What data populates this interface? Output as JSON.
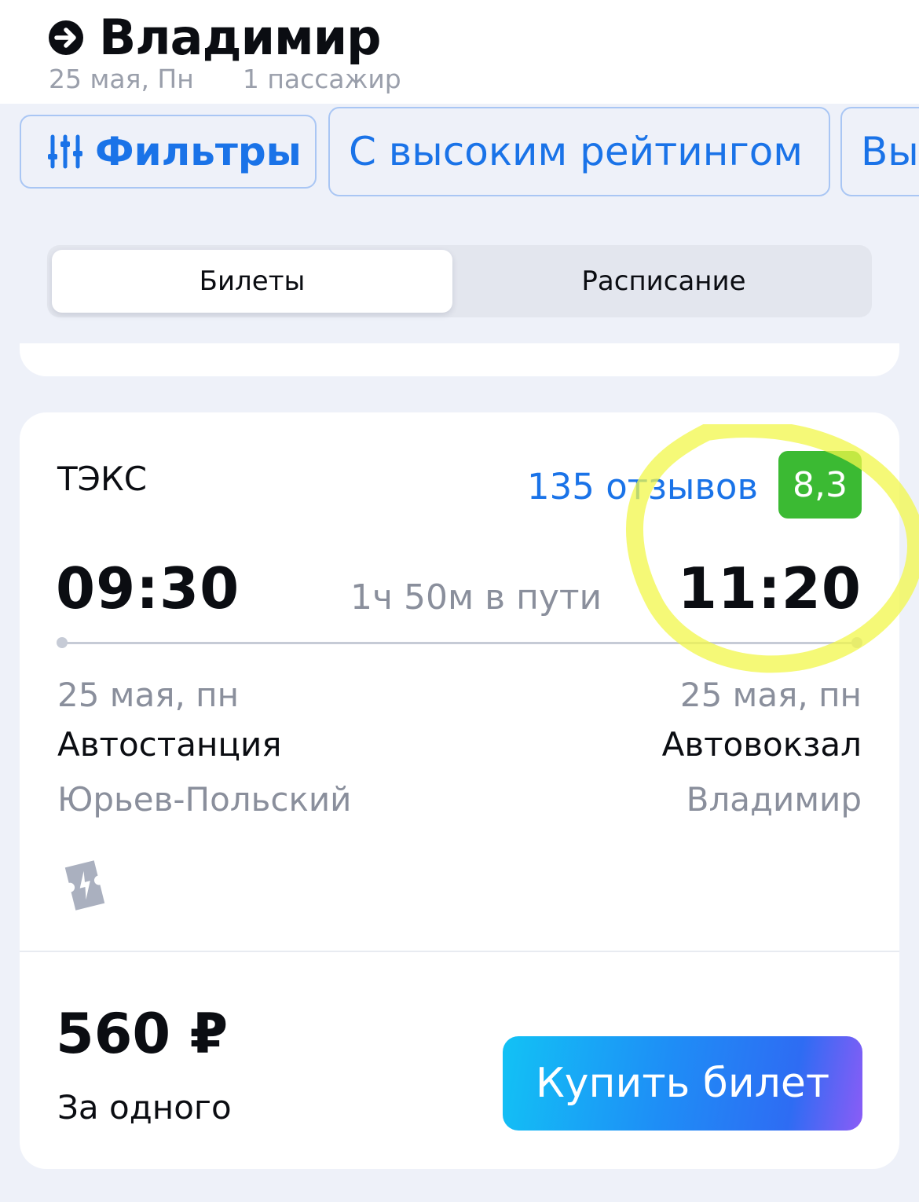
{
  "header": {
    "title": "Владимир",
    "date": "25 мая, Пн",
    "passengers": "1 пассажир",
    "arrow_icon": "arrow-right-circle-icon"
  },
  "chips": [
    {
      "label": "Фильтры",
      "icon": "filter-sliders-icon"
    },
    {
      "label": "С высоким рейтингом"
    },
    {
      "label": "Вы"
    }
  ],
  "tabs": {
    "tickets": "Билеты",
    "schedule": "Расписание",
    "selected": "tickets"
  },
  "trip": {
    "carrier": "ТЭКС",
    "reviews": "135 отзывов",
    "rating": "8,3",
    "departure_time": "09:30",
    "arrival_time": "11:20",
    "duration": "1ч 50м в пути",
    "departure": {
      "date": "25 мая, пн",
      "station": "Автостанция",
      "city": "Юрьев-Польский"
    },
    "arrival": {
      "date": "25 мая, пн",
      "station": "Автовокзал",
      "city": "Владимир"
    },
    "ticket_icon": "electronic-ticket-icon",
    "price": "560 ₽",
    "price_note": "За одного",
    "buy_label": "Купить билет"
  },
  "colors": {
    "accent": "#1a73e8",
    "rating_badge": "#3bba33",
    "highlight": "#f2f74a"
  }
}
